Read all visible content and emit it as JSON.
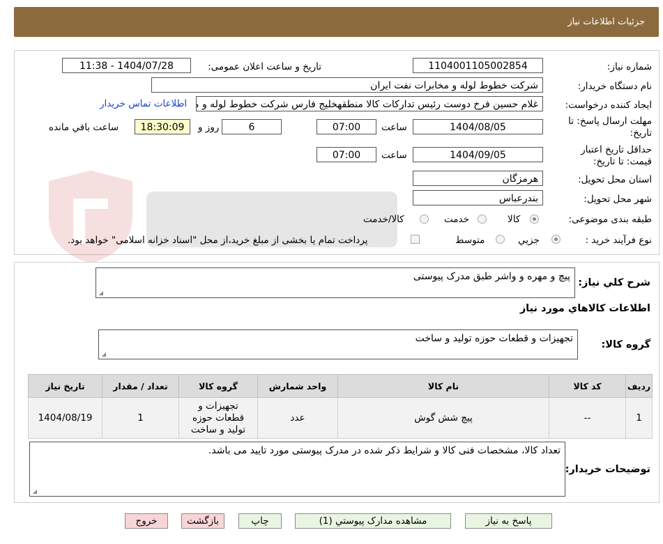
{
  "header": {
    "title": "جزئیات اطلاعات نیاز"
  },
  "form": {
    "need_number_label": "شماره نیاز:",
    "need_number": "1104001105002854",
    "announce_label": "تاریخ و ساعت اعلان عمومی:",
    "announce_value": "1404/07/28 - 11:38",
    "buyer_label": "نام دستگاه خریدار:",
    "buyer_value": "شرکت خطوط لوله و مخابرات نفت ایران",
    "creator_label": "ایجاد کننده درخواست:",
    "creator_value": "غلام حسین فرخ دوست رئیس تدارکات کالا منطقهخلیج فارس شرکت خطوط لوله و مخابرات نفت ایران",
    "contact_link": "اطلاعات تماس خریدار",
    "deadline_label_1": "مهلت ارسال پاسخ: تا",
    "deadline_label_2": "تاریخ:",
    "deadline_date": "1404/08/05",
    "time_label": "ساعت",
    "deadline_time": "07:00",
    "days_value": "6",
    "days_label": "روز و",
    "remaining_time": "18:30:09",
    "remaining_label": "ساعت باقي مانده",
    "validity_label_1": "حداقل تاریخ اعتبار",
    "validity_label_2": "قیمت: تا تاریخ:",
    "validity_date": "1404/09/05",
    "validity_time": "07:00",
    "province_label": "استان محل تحویل:",
    "province_value": "هرمزگان",
    "city_label": "شهر محل تحویل:",
    "city_value": "بندرعباس",
    "category_label": "طبقه بندی موضوعی:",
    "category_options": [
      "کالا",
      "خدمت",
      "کالا/خدمت"
    ],
    "process_label": "نوع فرآیند خرید :",
    "process_options": [
      "جزیي",
      "متوسط"
    ],
    "payment_note": "پرداخت تمام یا بخشی از مبلغ خرید،از محل \"اسناد خزانه اسلامی\" خواهد بود."
  },
  "description": {
    "label": "شرح کلي نياز:",
    "value": "پیچ و مهره و واشر طبق مدرک پیوستی"
  },
  "goods_section_title": "اطلاعات کالاهاي مورد نياز",
  "goods_group": {
    "label": "گروه کالا:",
    "value": "تجهیزات و قطعات حوزه تولید و ساخت"
  },
  "table": {
    "headers": [
      "ردیف",
      "کد کالا",
      "نام کالا",
      "واحد شمارش",
      "گروه کالا",
      "تعداد / مقدار",
      "تاریخ نیاز"
    ],
    "rows": [
      [
        "1",
        "--",
        "پیچ شش گوش",
        "عدد",
        "تجهیزات و قطعات حوزه تولید و ساخت",
        "1",
        "1404/08/19"
      ]
    ]
  },
  "buyer_notes": {
    "label": "توضیحات خریدار:",
    "value": "تعداد کالا، مشخصات فنی کالا و شرایط ذکر شده در مدرک پیوستی مورد تایید می باشد."
  },
  "buttons": {
    "reply": "پاسخ به نیاز",
    "view_docs": "مشاهده مدارک پیوستي (1)",
    "print": "چاپ",
    "back": "بازگشت",
    "exit": "خروج"
  },
  "colors": {
    "header_bg": "#8b6a3e",
    "link": "#1a44cc",
    "button_green": "#e9f5e3",
    "button_pink": "#f9d6d6"
  }
}
